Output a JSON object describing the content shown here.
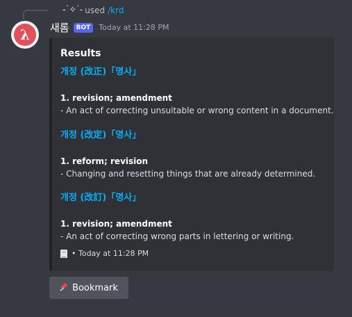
{
  "reply": {
    "sparkle_icon": "sparkle-icon",
    "text": "used",
    "command": "/krd"
  },
  "author": {
    "avatar_glyph": "λ",
    "name": "새롬",
    "bot_tag": "BOT",
    "timestamp": "Today at 11:28 PM"
  },
  "embed": {
    "title": "Results",
    "fields": [
      {
        "name": "개정 (改正)「명사」",
        "def_title": "1. revision; amendment",
        "def_text": "- An act of correcting unsuitable or wrong content in a document."
      },
      {
        "name": "개정 (改定)「명사」",
        "def_title": "1. reform; revision",
        "def_text": "- Changing and resetting things that are already determined."
      },
      {
        "name": "개정 (改訂)「명사」",
        "def_title": "1. revision; amendment",
        "def_text": "- An act of correcting wrong parts in lettering or writing."
      }
    ],
    "footer_text": "• Today at 11:28 PM"
  },
  "button": {
    "label": "Bookmark",
    "icon": "pushpin-icon"
  },
  "colors": {
    "background": "#36393f",
    "embed_bg": "#2f3136",
    "link": "#00aff4",
    "bot_tag": "#5865f2",
    "avatar": "#e0515a",
    "button": "#4f545c"
  }
}
